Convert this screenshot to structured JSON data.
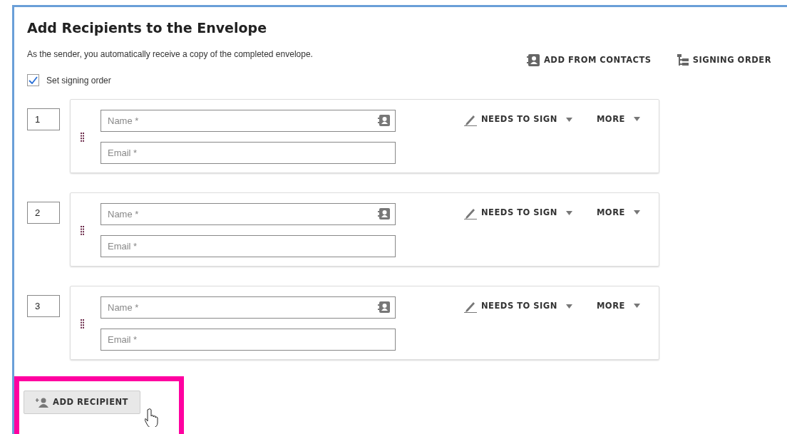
{
  "title": "Add Recipients to the Envelope",
  "subtitle": "As the sender, you automatically receive a copy of the completed envelope.",
  "actions": [
    {
      "kind": "contacts",
      "label": "ADD FROM CONTACTS"
    },
    {
      "kind": "order",
      "label": "SIGNING ORDER"
    }
  ],
  "signing_order": {
    "label": "Set signing order",
    "checked": true
  },
  "recipients": [
    {
      "order": "1",
      "name_placeholder": "Name *",
      "email_placeholder": "Email *",
      "role": "NEEDS TO SIGN",
      "more": "MORE"
    },
    {
      "order": "2",
      "name_placeholder": "Name *",
      "email_placeholder": "Email *",
      "role": "NEEDS TO SIGN",
      "more": "MORE"
    },
    {
      "order": "3",
      "name_placeholder": "Name *",
      "email_placeholder": "Email *",
      "role": "NEEDS TO SIGN",
      "more": "MORE"
    }
  ],
  "add_button": {
    "label": "ADD RECIPIENT",
    "highlighted": true
  }
}
